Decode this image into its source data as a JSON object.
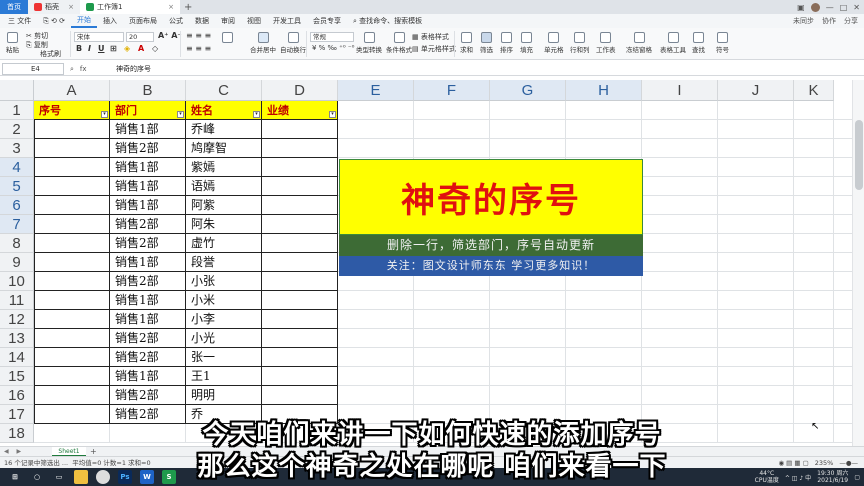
{
  "window": {
    "tabs": [
      {
        "label": "首页"
      },
      {
        "label": "稻壳"
      },
      {
        "label": "工作簿1"
      }
    ],
    "new_tab": "+",
    "avatar_label": ""
  },
  "menubar": {
    "file": "三 文件",
    "items": [
      "开始",
      "插入",
      "页面布局",
      "公式",
      "数据",
      "审阅",
      "视图",
      "开发工具",
      "会员专享"
    ],
    "search": "查找命令、搜索模板",
    "right": [
      "未同步",
      "协作",
      "分享"
    ]
  },
  "ribbon": {
    "paste": "粘贴",
    "cut": "剪切",
    "copy": "复制",
    "format_painter": "格式刷",
    "font_name": "宋体",
    "font_size": "20",
    "merge": "合并居中",
    "wrap": "自动换行",
    "number_format": "常规",
    "type_convert": "类型转换",
    "cond_format": "条件格式",
    "table_style": "表格样式",
    "cell_style": "单元格样式",
    "sum": "求和",
    "filter": "筛选",
    "sort": "排序",
    "fill": "填充",
    "cell": "单元格",
    "row_col": "行和列",
    "worksheet": "工作表",
    "freeze": "冻结窗格",
    "table_tools": "表格工具",
    "find": "查找",
    "symbol": "符号"
  },
  "formula": {
    "cell_ref": "E4",
    "fx": "fx",
    "content": "神奇的序号"
  },
  "sheet": {
    "columns": [
      "A",
      "B",
      "C",
      "D",
      "E",
      "F",
      "G",
      "H",
      "I",
      "J",
      "K"
    ],
    "rows": [
      "1",
      "2",
      "3",
      "4",
      "5",
      "6",
      "7",
      "8",
      "9",
      "10",
      "11",
      "12",
      "13",
      "14",
      "15",
      "16",
      "17",
      "18"
    ],
    "headers": {
      "A": "序号",
      "B": "部门",
      "C": "姓名",
      "D": "业绩"
    },
    "data": [
      {
        "dept": "销售1部",
        "name": "乔峰"
      },
      {
        "dept": "销售2部",
        "name": "鸠摩智"
      },
      {
        "dept": "销售1部",
        "name": "紫嫣"
      },
      {
        "dept": "销售1部",
        "name": "语嫣"
      },
      {
        "dept": "销售1部",
        "name": "阿紫"
      },
      {
        "dept": "销售2部",
        "name": "阿朱"
      },
      {
        "dept": "销售2部",
        "name": "虚竹"
      },
      {
        "dept": "销售1部",
        "name": "段誉"
      },
      {
        "dept": "销售2部",
        "name": "小张"
      },
      {
        "dept": "销售1部",
        "name": "小米"
      },
      {
        "dept": "销售1部",
        "name": "小李"
      },
      {
        "dept": "销售2部",
        "name": "小光"
      },
      {
        "dept": "销售2部",
        "name": "张一"
      },
      {
        "dept": "销售1部",
        "name": "王1"
      },
      {
        "dept": "销售2部",
        "name": "明明"
      },
      {
        "dept": "销售2部",
        "name": "乔"
      }
    ],
    "filter_arrow": "▾"
  },
  "banner": {
    "title": "神奇的序号",
    "line1": "删除一行，筛选部门，序号自动更新",
    "line2": "关注：图文设计师东东   学习更多知识！"
  },
  "sheet_tabs": {
    "active": "Sheet1",
    "add": "+",
    "nav": "◀ ▶"
  },
  "status": {
    "left": "16 个记录中筛选出 ...",
    "stats": "平均值=0  计数=1  求和=0",
    "zoom": "235%"
  },
  "taskbar": {
    "time": "19:30 周六",
    "date": "2021/6/19",
    "cpu": "CPU温度",
    "temp": "44°C"
  },
  "subtitles": {
    "line1": "今天咱们来讲一下如何快速的添加序号",
    "line2": "那么这个神奇之处在哪呢 咱们来看一下"
  },
  "colors": {
    "header_yellow": "#ffff00",
    "header_red": "#c00000",
    "banner_green": "#3d6b35",
    "banner_blue": "#2e5aa6",
    "accent": "#2b7ad6"
  }
}
